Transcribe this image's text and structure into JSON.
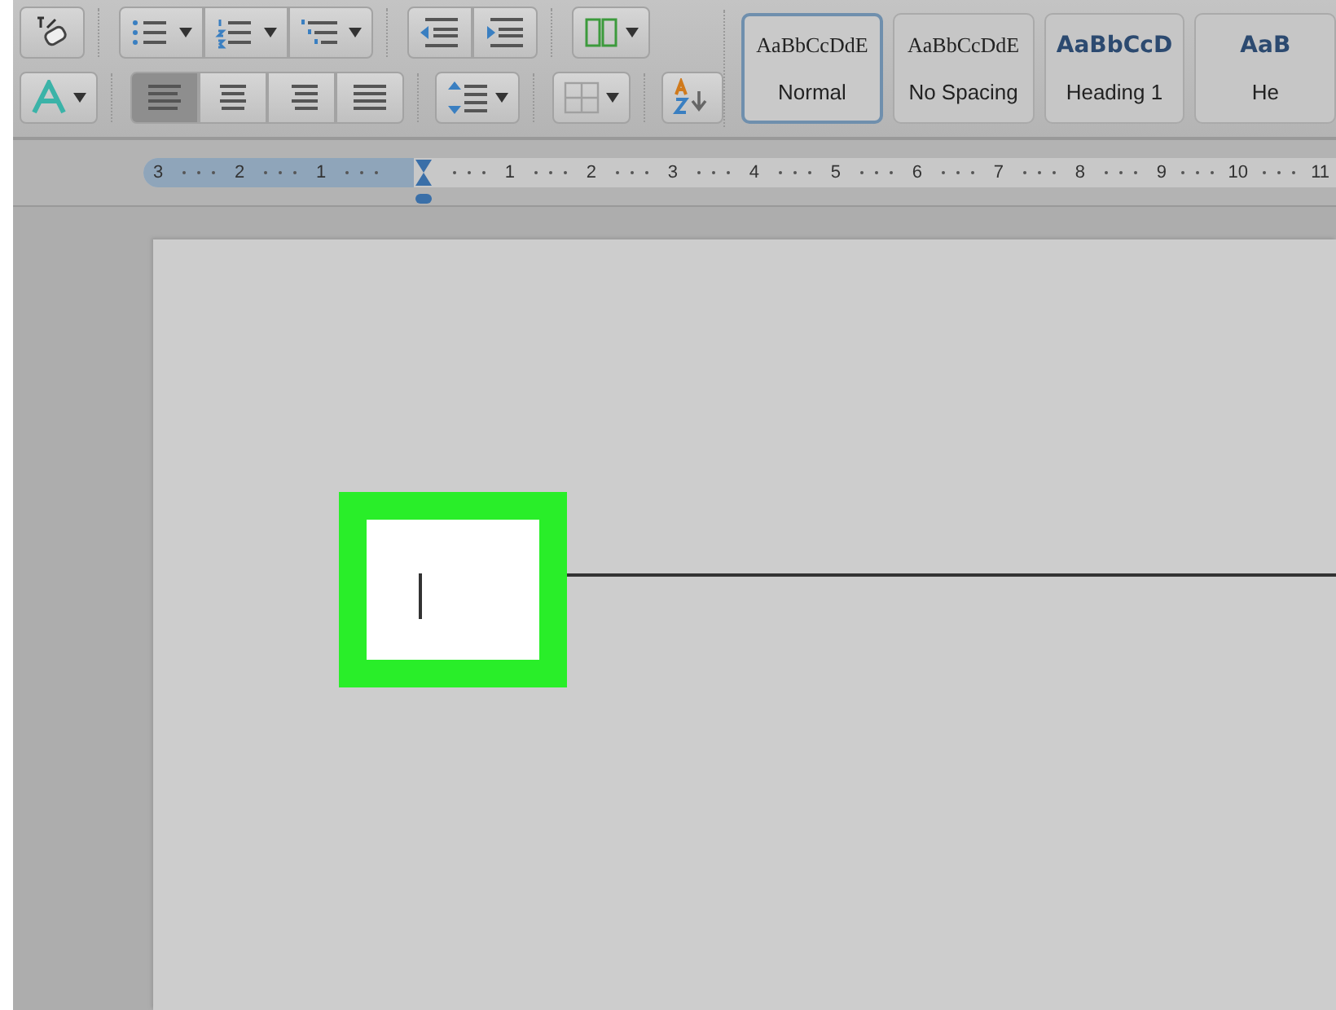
{
  "toolbar": {
    "alignment": [
      {
        "selected": true
      },
      {
        "selected": false
      },
      {
        "selected": false
      },
      {
        "selected": false
      }
    ]
  },
  "styles": [
    {
      "preview": "AaBbCcDdE",
      "name": "Normal",
      "kind": "body",
      "selected": true
    },
    {
      "preview": "AaBbCcDdE",
      "name": "No Spacing",
      "kind": "body",
      "selected": false
    },
    {
      "preview": "AaBbCcD",
      "name": "Heading 1",
      "kind": "heading",
      "selected": false
    },
    {
      "preview": "AaB",
      "name": "He",
      "kind": "heading",
      "selected": false
    }
  ],
  "ruler": {
    "left_labels": [
      "3",
      "2",
      "1"
    ],
    "right_labels": [
      "1",
      "2",
      "3",
      "4",
      "5",
      "6",
      "7",
      "8",
      "9",
      "10",
      "11"
    ]
  }
}
